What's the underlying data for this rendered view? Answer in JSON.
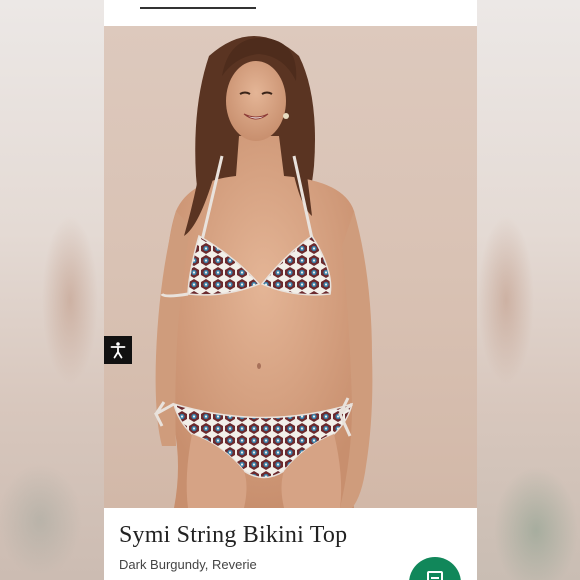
{
  "product": {
    "title": "Symi String Bikini Top",
    "color_variant": "Dark Burgundy, Reverie"
  },
  "carousel": {
    "dot_count": 6,
    "active_index": 0
  },
  "icons": {
    "accessibility": "accessibility-person-icon",
    "floating_action": "chat-icon"
  },
  "colors": {
    "fab_background": "#11875a",
    "accessibility_background": "#111111"
  }
}
